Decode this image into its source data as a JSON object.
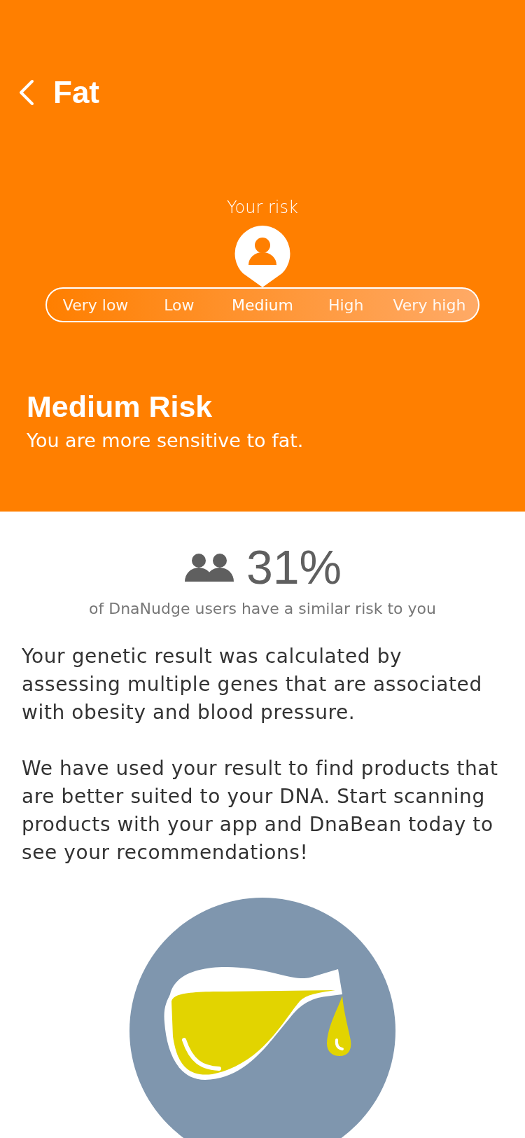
{
  "header": {
    "title": "Fat"
  },
  "risk": {
    "label": "Your risk",
    "levels": [
      {
        "label": "Very low",
        "selected": false
      },
      {
        "label": "Low",
        "selected": false
      },
      {
        "label": "Medium",
        "selected": true
      },
      {
        "label": "High",
        "selected": false
      },
      {
        "label": "Very high",
        "selected": false
      }
    ],
    "heading": "Medium Risk",
    "summary": "You are more sensitive to fat."
  },
  "stat": {
    "value": "31%",
    "caption": "of DnaNudge users have a similar risk to you"
  },
  "paragraphs": [
    "Your genetic result was calculated by assessing multiple genes that are associated with obesity and blood pressure.",
    "We have used your result to find products that are better suited to your DNA. Start scanning products with your app and DnaBean today to see your recommendations!"
  ]
}
